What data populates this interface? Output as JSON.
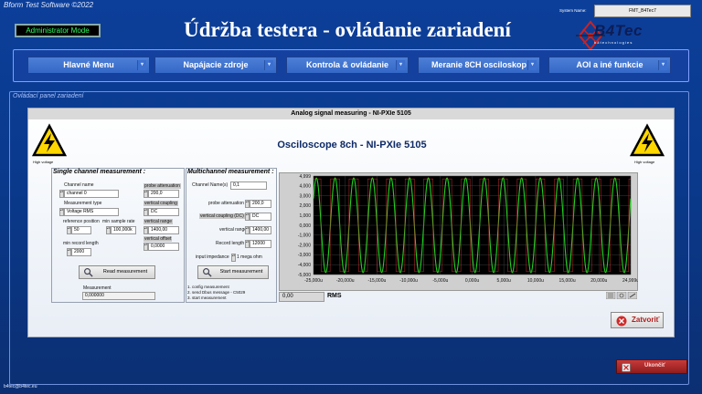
{
  "header": {
    "software_label": "Bform Test Software ©2022",
    "system_name_label": "System Name:",
    "system_name_value": "FMT_B4Tec7",
    "admin_mode": "Administrator Mode",
    "title": "Údržba testera - ovládanie zariadení",
    "logo_text": "B4Tec",
    "logo_sub": "b   4   t   e   c   h   n   o   l   o   g   i   e   s"
  },
  "nav": {
    "items": [
      {
        "label": "Hlavné Menu"
      },
      {
        "label": "Napájacie zdroje"
      },
      {
        "label": "Kontrola & ovládanie"
      },
      {
        "label": "Meranie 8CH osciloskop"
      },
      {
        "label": "AOI a iné funkcie"
      }
    ]
  },
  "panel": {
    "label": "Ovládací panel zariadení",
    "window_title": "Analog signal measuring - NI-PXIe 5105",
    "scope_title": "Osciloscope 8ch - NI-PXIe 5105",
    "warning_label": "High voltage"
  },
  "single": {
    "title": "Single channel measurement :",
    "channel_name_label": "Channel name",
    "channel_name_value": "channel 0",
    "probe_attenuation_label": "probe attenuation",
    "probe_attenuation_value": "200,0",
    "measurement_type_label": "Measurement type",
    "measurement_type_value": "Voltage RMS",
    "vertical_coupling_label": "vertical coupling",
    "vertical_coupling_value": "DC",
    "reference_position_label": "reference position",
    "reference_position_value": "50",
    "min_sample_rate_label": "min sample rate",
    "min_sample_rate_value": "100,000k",
    "vertical_range_label": "vertical range",
    "vertical_range_value": "1400,00",
    "min_record_length_label": "min record length",
    "min_record_length_value": "2000",
    "vertical_offset_label": "vertical offset",
    "vertical_offset_value": "0,0000",
    "read_button": "Read measurement",
    "measurement_label": "Measurement",
    "measurement_value": "0,000000"
  },
  "multi": {
    "title": "Multichannel measurement :",
    "channel_names_label": "Channel Name(s)",
    "channel_names_value": "0,1",
    "probe_attenuation_label": "probe attenuation",
    "probe_attenuation_value": "200,0",
    "vertical_coupling_label": "vertical coupling (DC)",
    "vertical_coupling_value": "DC",
    "vertical_range_label": "vertical range",
    "vertical_range_value": "1400,00",
    "record_length_label": "Record length",
    "record_length_value": "12000",
    "input_impedance_label": "input impedance",
    "input_impedance_value": "1 mega ohm",
    "start_button": "Start measurement",
    "steps": [
      "1. config measurement",
      "2. send Dbus message - C5029",
      "3. start measurement"
    ]
  },
  "chart_data": {
    "type": "line",
    "title": "",
    "xlabel": "",
    "ylabel": "",
    "xlim": [
      -25000,
      24999
    ],
    "ylim": [
      -5000,
      4999
    ],
    "x_ticks": [
      "-25,000u",
      "-20,000u",
      "-15,000u",
      "-10,000u",
      "-5,000u",
      "0,000u",
      "5,000u",
      "10,000u",
      "15,000u",
      "20,000u",
      "24,999u"
    ],
    "y_ticks": [
      "4,999",
      "4,000",
      "3,000",
      "2,000",
      "1,000",
      "0,000",
      "-1,000",
      "-2,000",
      "-3,000",
      "-4,000",
      "-5,000"
    ],
    "grid": true,
    "background": "#000000",
    "series": [
      {
        "color": "#22d022",
        "amplitude": 4800,
        "cycles": 17,
        "style": "sine"
      },
      {
        "color": "#d03030",
        "amplitude": 4800,
        "cycles": 17,
        "style": "flat-band"
      }
    ],
    "readout_value": "0,00",
    "readout_unit": "RMS"
  },
  "buttons": {
    "close": "Zatvoriť",
    "exit": "Ukončiť"
  },
  "footer": {
    "email": "b4tec@b4tec.eu"
  },
  "colors": {
    "background": "#0c3f9a",
    "nav_button": "#4070d0",
    "admin_text": "#33ff66",
    "plot_green": "#22d022",
    "plot_red": "#d03030"
  }
}
